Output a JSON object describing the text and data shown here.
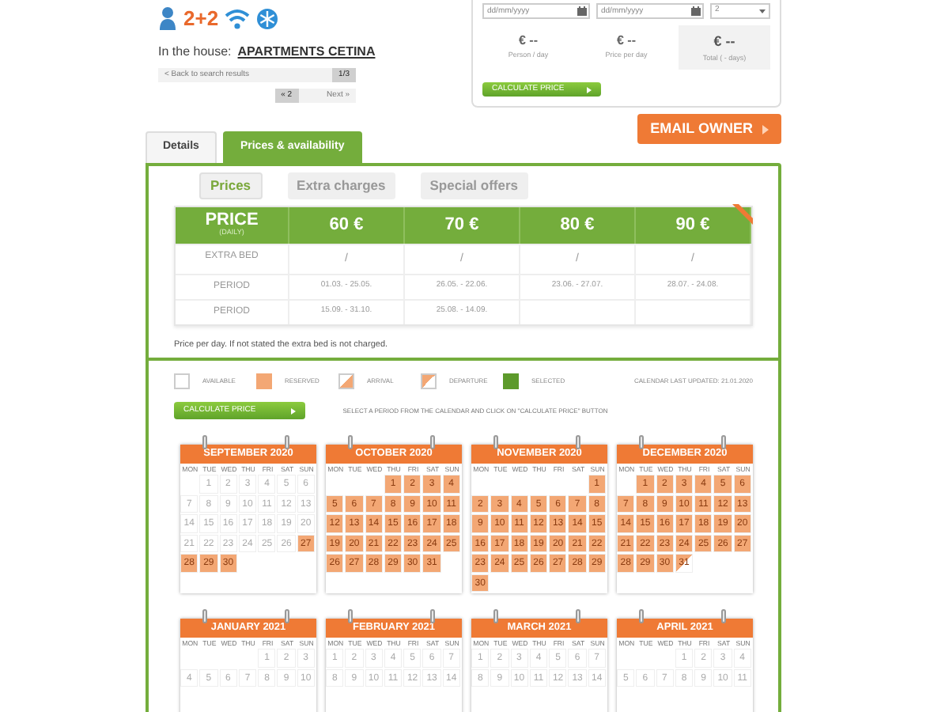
{
  "amenities": {
    "guests": "2+2"
  },
  "house": {
    "label": "In the house:",
    "name": "APARTMENTS CETINA"
  },
  "navigation": {
    "back": "< Back to search results",
    "back_count": "1/3",
    "prev": "« 2",
    "next": "Next »"
  },
  "booking": {
    "date_from": {
      "placeholder": "dd/mm/yyyy"
    },
    "date_to": {
      "placeholder": "dd/mm/yyyy"
    },
    "persons": "2",
    "results": [
      {
        "value": "€ --",
        "label": "Person / day",
        "highlight": false
      },
      {
        "value": "€ --",
        "label": "Price per day",
        "highlight": false
      },
      {
        "value": "€ --",
        "label": "Total ( - days)",
        "highlight": true
      }
    ],
    "calculate": "CALCULATE PRICE"
  },
  "email_owner": "EMAIL OWNER",
  "tabs": [
    {
      "label": "Details",
      "selected": false
    },
    {
      "label": "Prices & availability",
      "selected": true
    }
  ],
  "subtabs": [
    {
      "label": "Prices",
      "selected": true
    },
    {
      "label": "Extra charges",
      "selected": false
    },
    {
      "label": "Special offers",
      "selected": false
    }
  ],
  "price_table": {
    "title": "PRICE",
    "subtitle": "(DAILY)",
    "prices": [
      "60 €",
      "70 €",
      "80 €",
      "90 €"
    ],
    "rows": [
      {
        "label": "EXTRA BED",
        "cells": [
          "/",
          "/",
          "/",
          "/"
        ]
      },
      {
        "label": "PERIOD",
        "cells": [
          "01.03. - 25.05.",
          "26.05. - 22.06.",
          "23.06. - 27.07.",
          "28.07. - 24.08."
        ]
      },
      {
        "label": "PERIOD",
        "cells": [
          "15.09. - 31.10.",
          "25.08. - 14.09."
        ]
      }
    ]
  },
  "price_note": "Price per day. If not stated the extra bed is not charged.",
  "legend": [
    {
      "kind": "available",
      "label": "AVAILABLE"
    },
    {
      "kind": "reserved",
      "label": "RESERVED"
    },
    {
      "kind": "arrival",
      "label": "ARRIVAL"
    },
    {
      "kind": "departure",
      "label": "DEPARTURE"
    },
    {
      "kind": "selected",
      "label": "SELECTED"
    }
  ],
  "calendar_updated": "CALENDAR LAST UPDATED: 21.01.2020",
  "calendar_calculate": "CALCULATE PRICE",
  "calendar_hint": "SELECT A PERIOD FROM THE CALENDAR AND CLICK ON \"CALCULATE PRICE\" BUTTON",
  "months": [
    {
      "title": "SEPTEMBER 2020",
      "weekdays": [
        "MON",
        "TUE",
        "WED",
        "THU",
        "FRI",
        "SAT",
        "SUN"
      ],
      "weeks": [
        [
          {
            "day": "1",
            "kind": "available"
          },
          {
            "day": "2",
            "kind": "available"
          },
          {
            "day": "3",
            "kind": "available"
          },
          {
            "day": "4",
            "kind": "available"
          },
          {
            "day": "5",
            "kind": "available"
          },
          {
            "day": "6",
            "kind": "available"
          }
        ],
        [
          {
            "day": "7",
            "kind": "available"
          },
          {
            "day": "8",
            "kind": "available"
          },
          {
            "day": "9",
            "kind": "available"
          },
          {
            "day": "10",
            "kind": "available"
          },
          {
            "day": "11",
            "kind": "available"
          },
          {
            "day": "12",
            "kind": "available"
          },
          {
            "day": "13",
            "kind": "available"
          }
        ],
        [
          {
            "day": "14",
            "kind": "available"
          },
          {
            "day": "15",
            "kind": "available"
          },
          {
            "day": "16",
            "kind": "available"
          },
          {
            "day": "17",
            "kind": "available"
          },
          {
            "day": "18",
            "kind": "available"
          },
          {
            "day": "19",
            "kind": "available"
          },
          {
            "day": "20",
            "kind": "available"
          }
        ],
        [
          {
            "day": "21",
            "kind": "available"
          },
          {
            "day": "22",
            "kind": "available"
          },
          {
            "day": "23",
            "kind": "available"
          },
          {
            "day": "24",
            "kind": "available"
          },
          {
            "day": "25",
            "kind": "available"
          },
          {
            "day": "26",
            "kind": "available"
          },
          {
            "day": "27",
            "kind": "reserved"
          }
        ],
        [
          {
            "day": "28",
            "kind": "reserved"
          },
          {
            "day": "29",
            "kind": "reserved"
          },
          {
            "day": "30",
            "kind": "reserved"
          }
        ]
      ]
    },
    {
      "title": "OCTOBER 2020",
      "weekdays": [
        "MON",
        "TUE",
        "WED",
        "THU",
        "FRI",
        "SAT",
        "SUN"
      ],
      "weeks": [
        [
          {
            "day": "1",
            "kind": "reserved"
          },
          {
            "day": "2",
            "kind": "reserved"
          },
          {
            "day": "3",
            "kind": "reserved"
          },
          {
            "day": "4",
            "kind": "reserved"
          }
        ],
        [
          {
            "day": "5",
            "kind": "reserved"
          },
          {
            "day": "6",
            "kind": "reserved"
          },
          {
            "day": "7",
            "kind": "reserved"
          },
          {
            "day": "8",
            "kind": "reserved"
          },
          {
            "day": "9",
            "kind": "reserved"
          },
          {
            "day": "10",
            "kind": "reserved"
          },
          {
            "day": "11",
            "kind": "reserved"
          }
        ],
        [
          {
            "day": "12",
            "kind": "reserved"
          },
          {
            "day": "13",
            "kind": "reserved"
          },
          {
            "day": "14",
            "kind": "reserved"
          },
          {
            "day": "15",
            "kind": "reserved"
          },
          {
            "day": "16",
            "kind": "reserved"
          },
          {
            "day": "17",
            "kind": "reserved"
          },
          {
            "day": "18",
            "kind": "reserved"
          }
        ],
        [
          {
            "day": "19",
            "kind": "reserved"
          },
          {
            "day": "20",
            "kind": "reserved"
          },
          {
            "day": "21",
            "kind": "reserved"
          },
          {
            "day": "22",
            "kind": "reserved"
          },
          {
            "day": "23",
            "kind": "reserved"
          },
          {
            "day": "24",
            "kind": "reserved"
          },
          {
            "day": "25",
            "kind": "reserved"
          }
        ],
        [
          {
            "day": "26",
            "kind": "reserved"
          },
          {
            "day": "27",
            "kind": "reserved"
          },
          {
            "day": "28",
            "kind": "reserved"
          },
          {
            "day": "29",
            "kind": "reserved"
          },
          {
            "day": "30",
            "kind": "reserved"
          },
          {
            "day": "31",
            "kind": "reserved"
          }
        ]
      ]
    },
    {
      "title": "NOVEMBER 2020",
      "weekdays": [
        "MON",
        "TUE",
        "WED",
        "THU",
        "FRI",
        "SAT",
        "SUN"
      ],
      "weeks": [
        [
          {
            "day": "1",
            "kind": "reserved"
          }
        ],
        [
          {
            "day": "2",
            "kind": "reserved"
          },
          {
            "day": "3",
            "kind": "reserved"
          },
          {
            "day": "4",
            "kind": "reserved"
          },
          {
            "day": "5",
            "kind": "reserved"
          },
          {
            "day": "6",
            "kind": "reserved"
          },
          {
            "day": "7",
            "kind": "reserved"
          },
          {
            "day": "8",
            "kind": "reserved"
          }
        ],
        [
          {
            "day": "9",
            "kind": "reserved"
          },
          {
            "day": "10",
            "kind": "reserved"
          },
          {
            "day": "11",
            "kind": "reserved"
          },
          {
            "day": "12",
            "kind": "reserved"
          },
          {
            "day": "13",
            "kind": "reserved"
          },
          {
            "day": "14",
            "kind": "reserved"
          },
          {
            "day": "15",
            "kind": "reserved"
          }
        ],
        [
          {
            "day": "16",
            "kind": "reserved"
          },
          {
            "day": "17",
            "kind": "reserved"
          },
          {
            "day": "18",
            "kind": "reserved"
          },
          {
            "day": "19",
            "kind": "reserved"
          },
          {
            "day": "20",
            "kind": "reserved"
          },
          {
            "day": "21",
            "kind": "reserved"
          },
          {
            "day": "22",
            "kind": "reserved"
          }
        ],
        [
          {
            "day": "23",
            "kind": "reserved"
          },
          {
            "day": "24",
            "kind": "reserved"
          },
          {
            "day": "25",
            "kind": "reserved"
          },
          {
            "day": "26",
            "kind": "reserved"
          },
          {
            "day": "27",
            "kind": "reserved"
          },
          {
            "day": "28",
            "kind": "reserved"
          },
          {
            "day": "29",
            "kind": "reserved"
          }
        ],
        [
          {
            "day": "30",
            "kind": "reserved"
          }
        ]
      ]
    },
    {
      "title": "DECEMBER 2020",
      "weekdays": [
        "MON",
        "TUE",
        "WED",
        "THU",
        "FRI",
        "SAT",
        "SUN"
      ],
      "weeks": [
        [
          {
            "day": "1",
            "kind": "reserved"
          },
          {
            "day": "2",
            "kind": "reserved"
          },
          {
            "day": "3",
            "kind": "reserved"
          },
          {
            "day": "4",
            "kind": "reserved"
          },
          {
            "day": "5",
            "kind": "reserved"
          },
          {
            "day": "6",
            "kind": "reserved"
          }
        ],
        [
          {
            "day": "7",
            "kind": "reserved"
          },
          {
            "day": "8",
            "kind": "reserved"
          },
          {
            "day": "9",
            "kind": "reserved"
          },
          {
            "day": "10",
            "kind": "reserved"
          },
          {
            "day": "11",
            "kind": "reserved"
          },
          {
            "day": "12",
            "kind": "reserved"
          },
          {
            "day": "13",
            "kind": "reserved"
          }
        ],
        [
          {
            "day": "14",
            "kind": "reserved"
          },
          {
            "day": "15",
            "kind": "reserved"
          },
          {
            "day": "16",
            "kind": "reserved"
          },
          {
            "day": "17",
            "kind": "reserved"
          },
          {
            "day": "18",
            "kind": "reserved"
          },
          {
            "day": "19",
            "kind": "reserved"
          },
          {
            "day": "20",
            "kind": "reserved"
          }
        ],
        [
          {
            "day": "21",
            "kind": "reserved"
          },
          {
            "day": "22",
            "kind": "reserved"
          },
          {
            "day": "23",
            "kind": "reserved"
          },
          {
            "day": "24",
            "kind": "reserved"
          },
          {
            "day": "25",
            "kind": "reserved"
          },
          {
            "day": "26",
            "kind": "reserved"
          },
          {
            "day": "27",
            "kind": "reserved"
          }
        ],
        [
          {
            "day": "28",
            "kind": "reserved"
          },
          {
            "day": "29",
            "kind": "reserved"
          },
          {
            "day": "30",
            "kind": "reserved"
          },
          {
            "day": "31",
            "kind": "departure"
          }
        ]
      ]
    },
    {
      "title": "JANUARY 2021",
      "weekdays": [
        "MON",
        "TUE",
        "WED",
        "THU",
        "FRI",
        "SAT",
        "SUN"
      ],
      "weeks": [
        [
          {
            "day": "1",
            "kind": "available"
          },
          {
            "day": "2",
            "kind": "available"
          },
          {
            "day": "3",
            "kind": "available"
          }
        ],
        [
          {
            "day": "4",
            "kind": "available"
          },
          {
            "day": "5",
            "kind": "available"
          },
          {
            "day": "6",
            "kind": "available"
          },
          {
            "day": "7",
            "kind": "available"
          },
          {
            "day": "8",
            "kind": "available"
          },
          {
            "day": "9",
            "kind": "available"
          },
          {
            "day": "10",
            "kind": "available"
          }
        ]
      ]
    },
    {
      "title": "FEBRUARY 2021",
      "weekdays": [
        "MON",
        "TUE",
        "WED",
        "THU",
        "FRI",
        "SAT",
        "SUN"
      ],
      "weeks": [
        [
          {
            "day": "1",
            "kind": "available"
          },
          {
            "day": "2",
            "kind": "available"
          },
          {
            "day": "3",
            "kind": "available"
          },
          {
            "day": "4",
            "kind": "available"
          },
          {
            "day": "5",
            "kind": "available"
          },
          {
            "day": "6",
            "kind": "available"
          },
          {
            "day": "7",
            "kind": "available"
          }
        ],
        [
          {
            "day": "8",
            "kind": "available"
          },
          {
            "day": "9",
            "kind": "available"
          },
          {
            "day": "10",
            "kind": "available"
          },
          {
            "day": "11",
            "kind": "available"
          },
          {
            "day": "12",
            "kind": "available"
          },
          {
            "day": "13",
            "kind": "available"
          },
          {
            "day": "14",
            "kind": "available"
          }
        ]
      ]
    },
    {
      "title": "MARCH 2021",
      "weekdays": [
        "MON",
        "TUE",
        "WED",
        "THU",
        "FRI",
        "SAT",
        "SUN"
      ],
      "weeks": [
        [
          {
            "day": "1",
            "kind": "available"
          },
          {
            "day": "2",
            "kind": "available"
          },
          {
            "day": "3",
            "kind": "available"
          },
          {
            "day": "4",
            "kind": "available"
          },
          {
            "day": "5",
            "kind": "available"
          },
          {
            "day": "6",
            "kind": "available"
          },
          {
            "day": "7",
            "kind": "available"
          }
        ],
        [
          {
            "day": "8",
            "kind": "available"
          },
          {
            "day": "9",
            "kind": "available"
          },
          {
            "day": "10",
            "kind": "available"
          },
          {
            "day": "11",
            "kind": "available"
          },
          {
            "day": "12",
            "kind": "available"
          },
          {
            "day": "13",
            "kind": "available"
          },
          {
            "day": "14",
            "kind": "available"
          }
        ]
      ]
    },
    {
      "title": "APRIL 2021",
      "weekdays": [
        "MON",
        "TUE",
        "WED",
        "THU",
        "FRI",
        "SAT",
        "SUN"
      ],
      "weeks": [
        [
          {
            "day": "1",
            "kind": "available"
          },
          {
            "day": "2",
            "kind": "available"
          },
          {
            "day": "3",
            "kind": "available"
          },
          {
            "day": "4",
            "kind": "available"
          }
        ],
        [
          {
            "day": "5",
            "kind": "available"
          },
          {
            "day": "6",
            "kind": "available"
          },
          {
            "day": "7",
            "kind": "available"
          },
          {
            "day": "8",
            "kind": "available"
          },
          {
            "day": "9",
            "kind": "available"
          },
          {
            "day": "10",
            "kind": "available"
          },
          {
            "day": "11",
            "kind": "available"
          }
        ]
      ]
    }
  ]
}
